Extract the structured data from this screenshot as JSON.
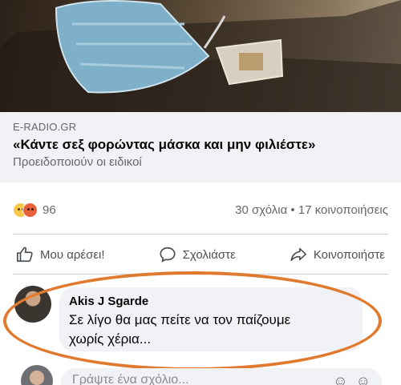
{
  "preview": {
    "source": "E-RADIO.GR",
    "headline": "«Κάντε σεξ φορώντας μάσκα και μην φιλιέστε»",
    "subtitle": "Προειδοποιούν οι ειδικοί"
  },
  "reactions": {
    "icons": [
      "haha-emoji-icon",
      "angry-emoji-icon"
    ],
    "count": "96",
    "comments_shares": "30 σχόλια • 17 κοινοποιήσεις"
  },
  "actions": {
    "like": "Μου αρέσει!",
    "comment": "Σχολιάστε",
    "share": "Κοινοποιήστε"
  },
  "comment": {
    "author": "Akis J Sgarde",
    "line1": "Σε λίγο θα μας πείτε να τον παίζουμε",
    "line2": "χωρίς χέρια..."
  },
  "compose": {
    "placeholder": "Γράψτε ένα σχόλιο..."
  },
  "colors": {
    "highlight_circle": "#e07a2f",
    "bubble_bg": "#f0f2f5"
  }
}
